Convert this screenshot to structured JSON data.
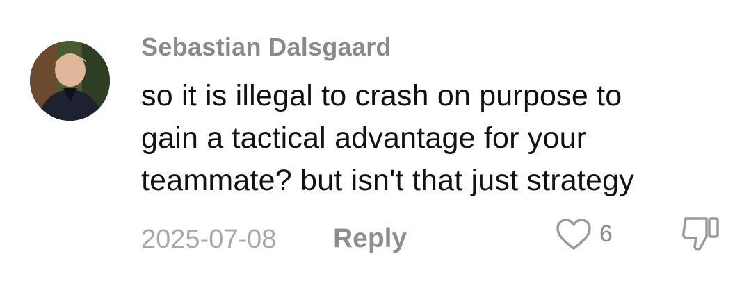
{
  "comment": {
    "author": "Sebastian Dalsgaard",
    "text_lines": [
      "so it is illegal to crash on purpose to",
      "gain a tactical advantage for your",
      "teammate? but isn't that just strategy"
    ],
    "date": "2025-07-08",
    "reply_label": "Reply",
    "like_count": "6",
    "icons": {
      "like": "heart-outline-icon",
      "dislike": "thumbs-down-outline-icon"
    },
    "colors": {
      "author": "#8a8a8a",
      "text": "#111111",
      "meta": "#a8a8a8",
      "reply": "#8e8e8e"
    }
  }
}
